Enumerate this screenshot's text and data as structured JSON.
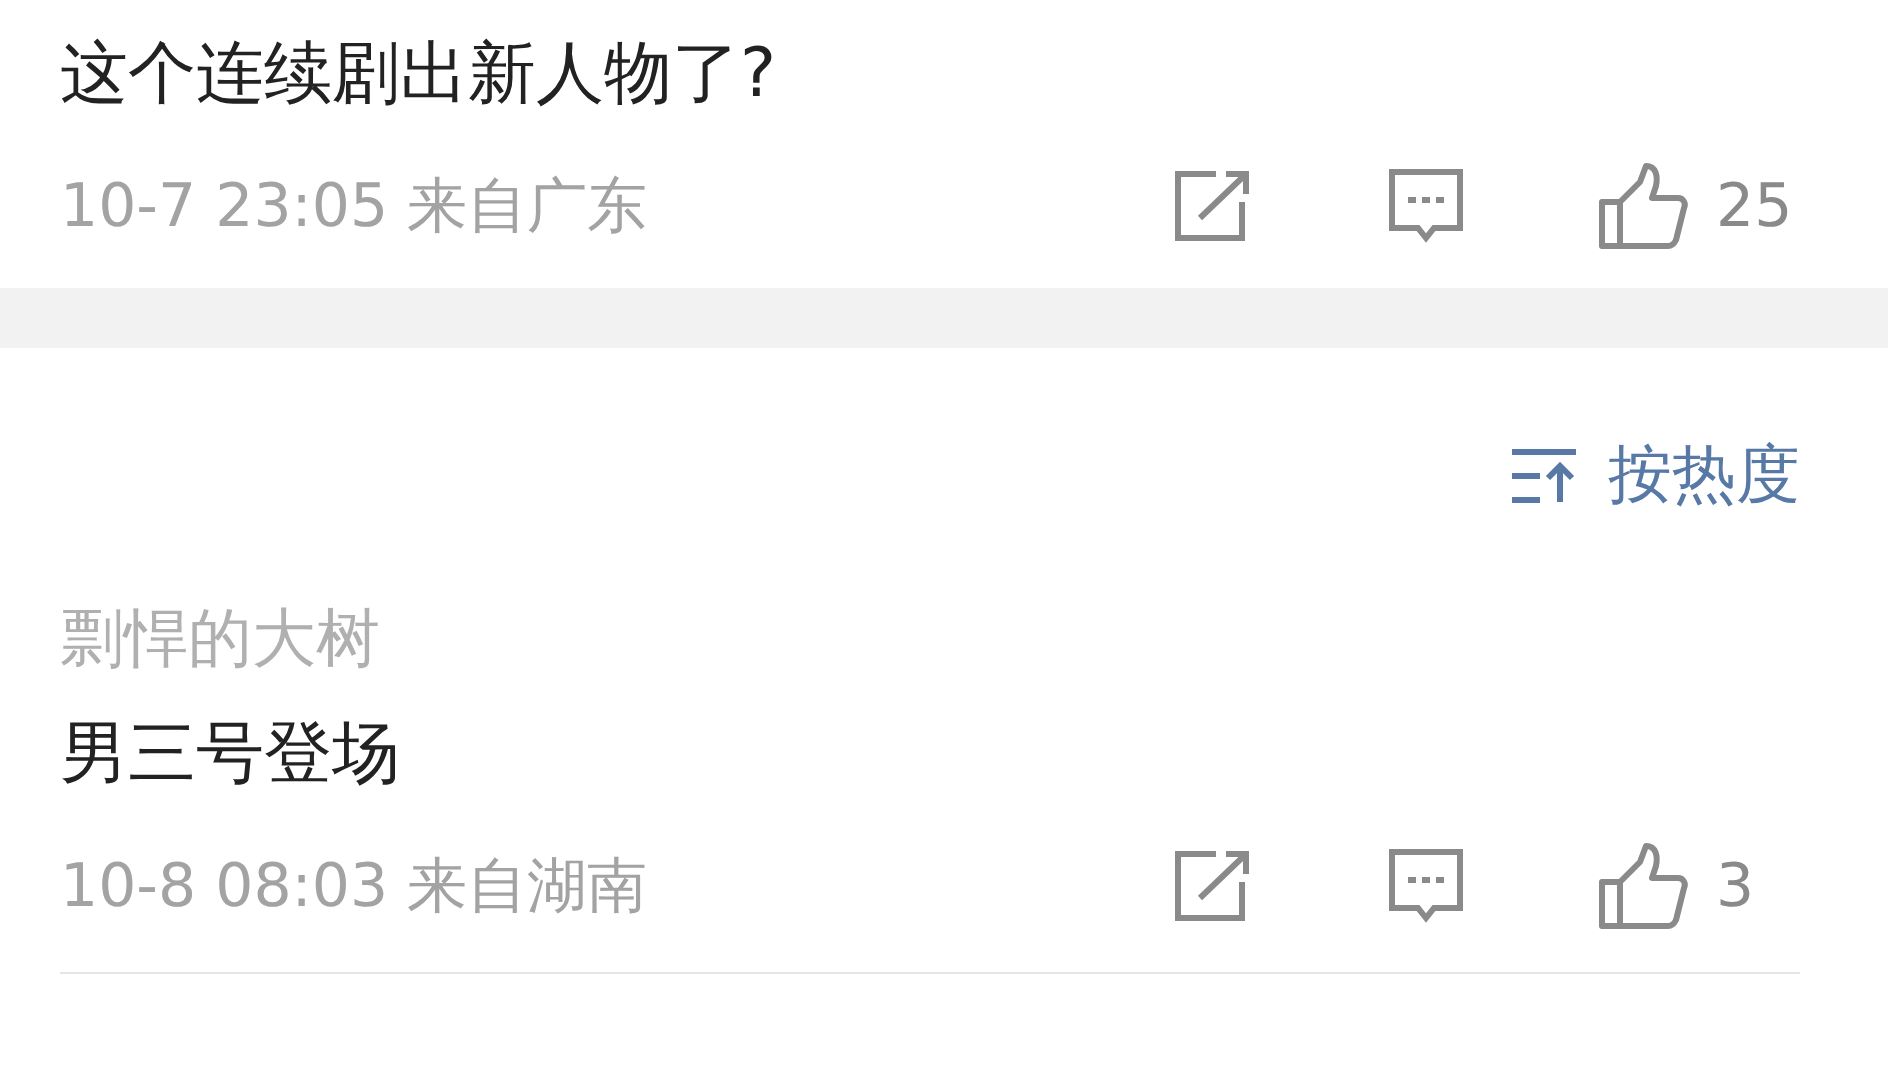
{
  "comments": [
    {
      "text": "这个连续剧出新人物了?",
      "time": "10-7 23:05",
      "location": "来自广东",
      "likes": "25"
    },
    {
      "username": "剽悍的大树",
      "text": "男三号登场",
      "time": "10-8 08:03",
      "location": "来自湖南",
      "likes": "3"
    }
  ],
  "sort": {
    "label": "按热度"
  }
}
